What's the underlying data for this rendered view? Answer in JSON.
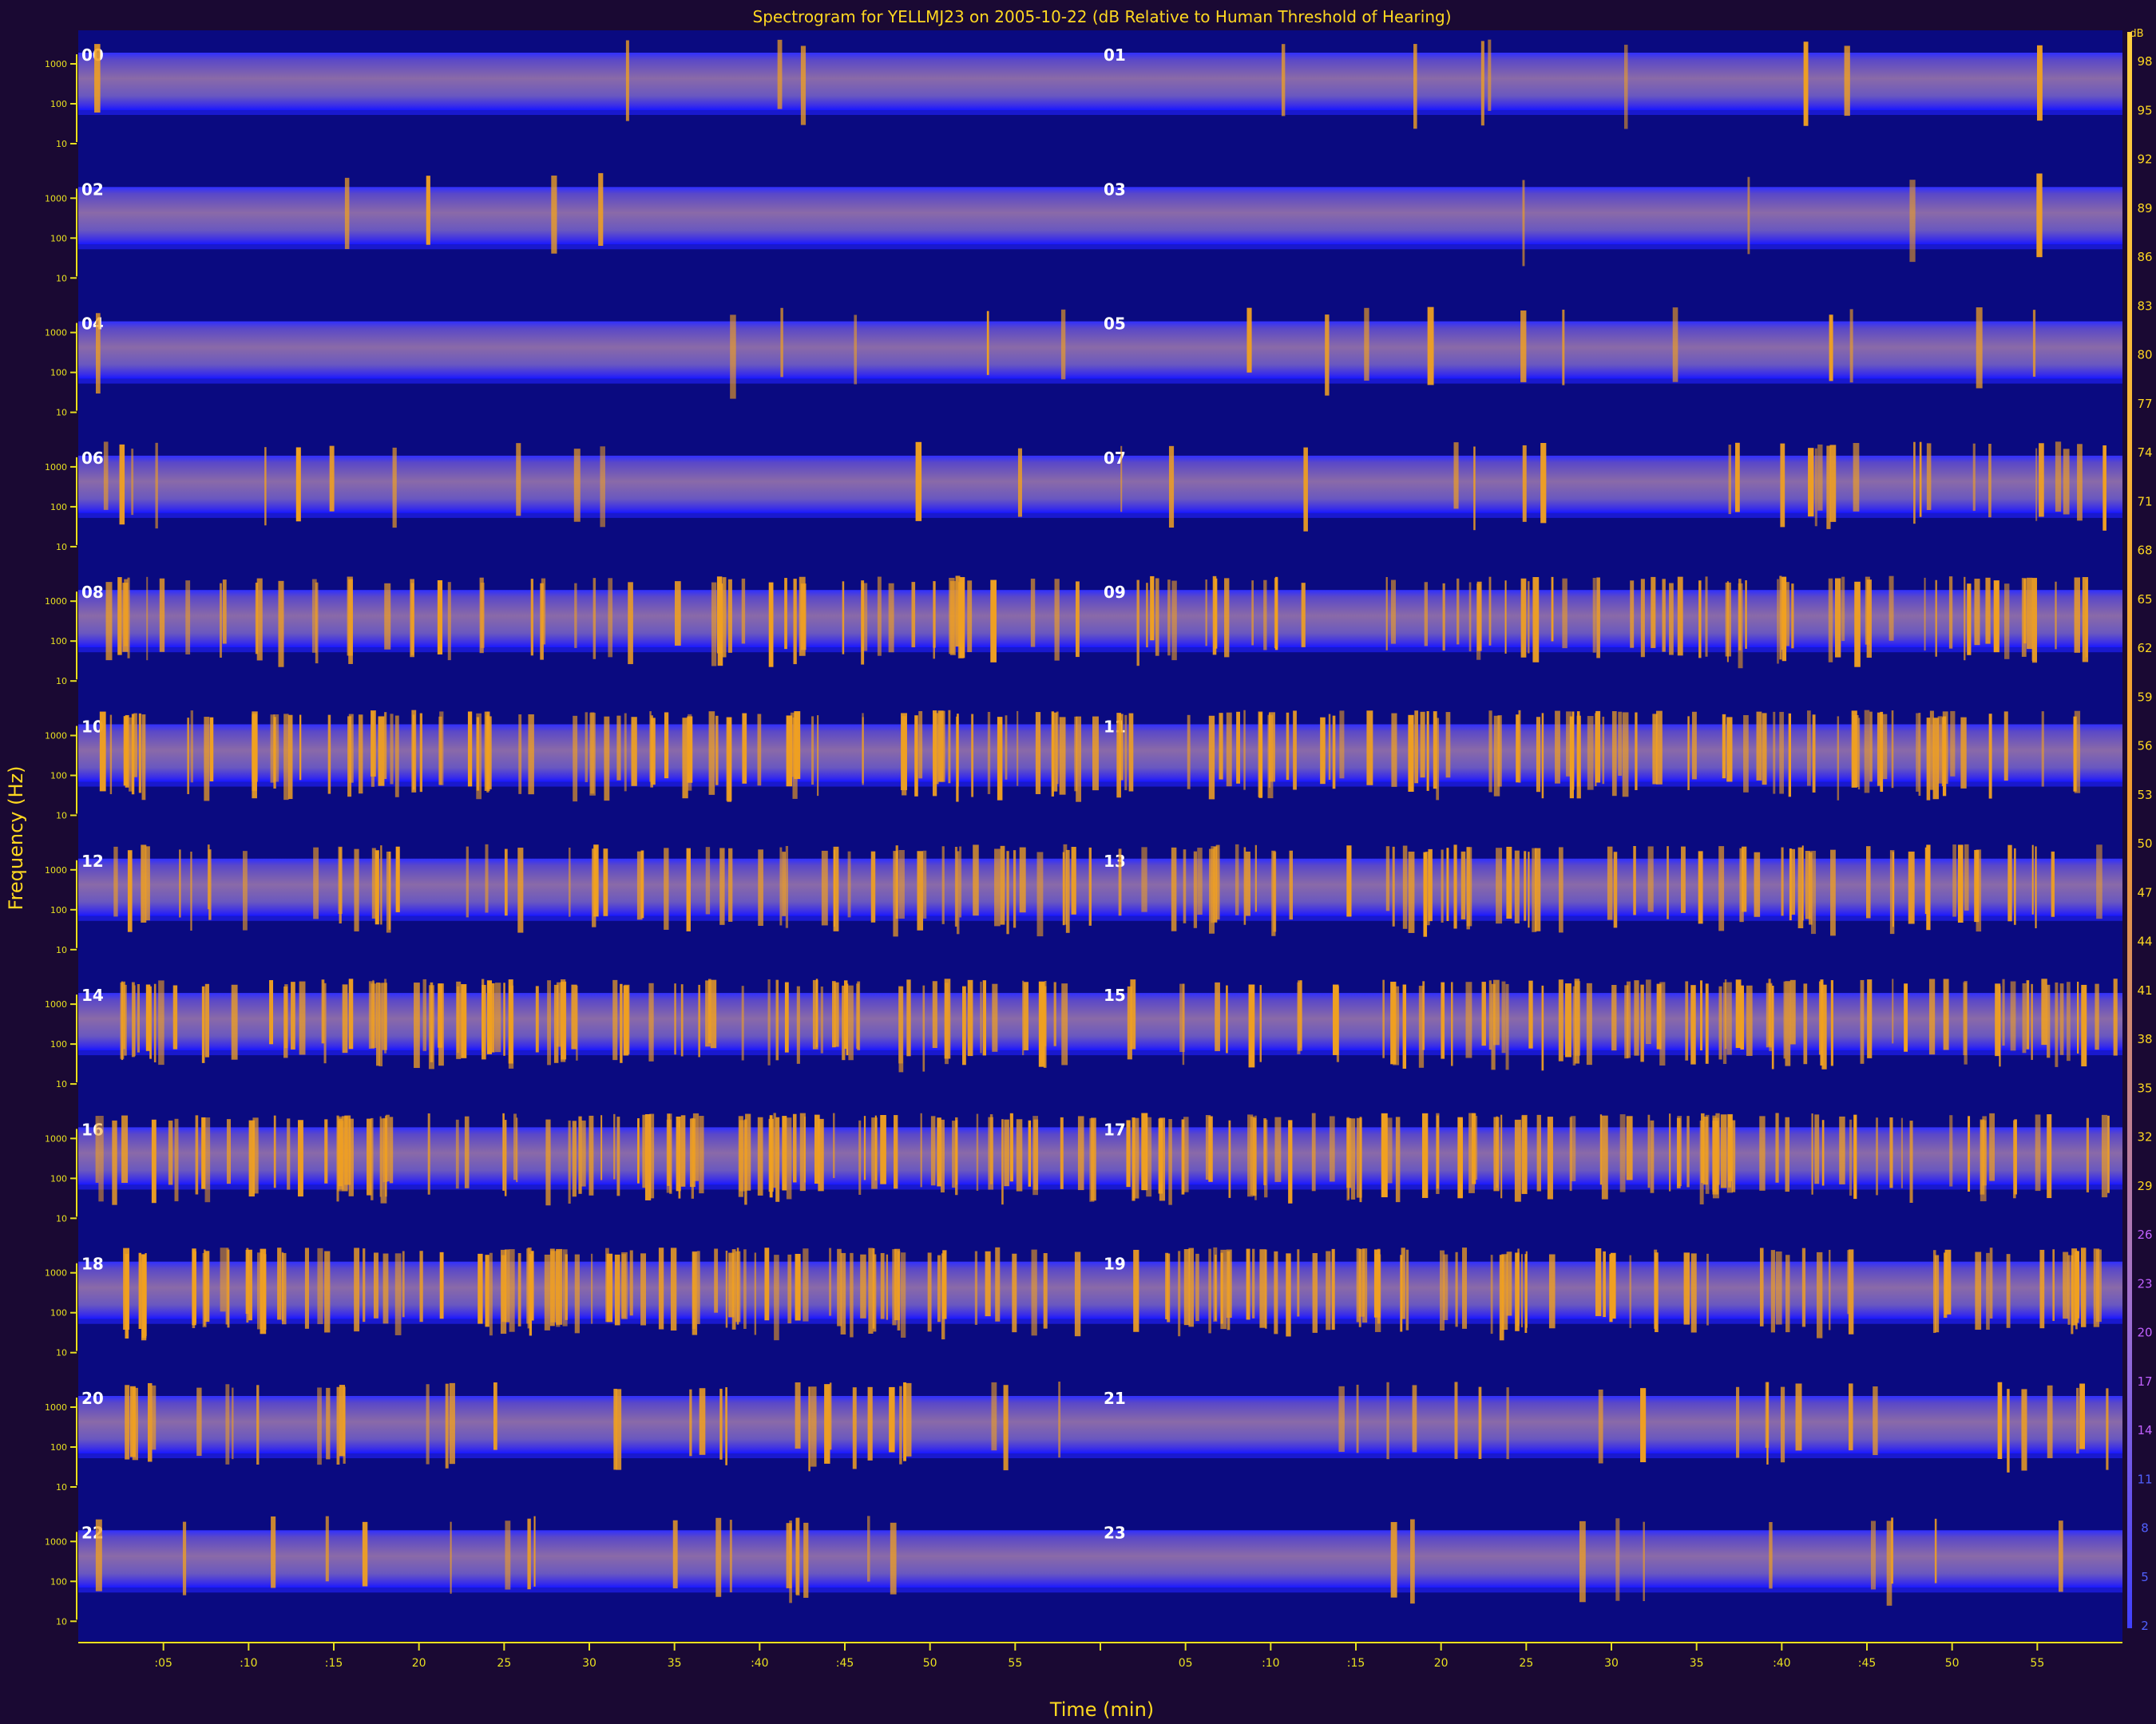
{
  "chart_data": {
    "type": "heatmap",
    "title": "Spectrogram for YELLMJ23 on 2005-10-22 (dB Relative to Human Threshold of Hearing)",
    "xlabel": "Time (min)",
    "ylabel": "Frequency (Hz)",
    "x_tick_labels": [
      ":05",
      ":10",
      ":15",
      "20",
      "25",
      "30",
      "35",
      ":40",
      ":45",
      "50",
      "55",
      "",
      "05",
      ":10",
      ":15",
      "20",
      "25",
      "30",
      "35",
      ":40",
      ":45",
      "50",
      "55"
    ],
    "y_tick_labels": [
      "1000",
      "100",
      "10"
    ],
    "colorbar_label": "dB",
    "colorbar_ticks": [
      98,
      95,
      92,
      89,
      86,
      83,
      80,
      77,
      74,
      71,
      68,
      65,
      62,
      59,
      56,
      53,
      50,
      47,
      44,
      41,
      38,
      35,
      32,
      29,
      26,
      23,
      20,
      17,
      14,
      11,
      8,
      5,
      2
    ],
    "hour_labels": [
      "00",
      "01",
      "02",
      "03",
      "04",
      "05",
      "06",
      "07",
      "08",
      "09",
      "10",
      "11",
      "12",
      "13",
      "14",
      "15",
      "16",
      "17",
      "18",
      "19",
      "20",
      "21",
      "22",
      "23"
    ],
    "event_density_per_hour": [
      0.1,
      0.2,
      0.1,
      0.1,
      0.15,
      0.3,
      0.35,
      0.7,
      1.6,
      2.0,
      2.6,
      2.4,
      1.7,
      2.0,
      2.7,
      2.4,
      2.8,
      2.6,
      2.8,
      2.3,
      1.0,
      0.6,
      0.5,
      0.3
    ],
    "colors": {
      "background": "#1a0933",
      "plot_bg": "#0a0a80",
      "band": "#6a5ab8",
      "event": "#f0a020",
      "axis": "#e8e020"
    }
  }
}
